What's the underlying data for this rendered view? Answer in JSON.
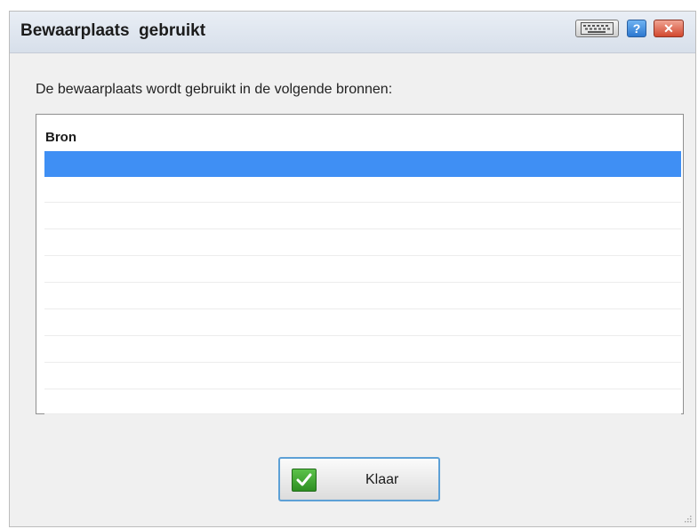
{
  "dialog": {
    "title": "Bewaarplaats  gebruikt",
    "message": "De bewaarplaats wordt gebruikt in de volgende bronnen:",
    "title_buttons": {
      "keyboard_icon": "keyboard-icon",
      "help_label": "?",
      "close_label": "✕"
    }
  },
  "table": {
    "column_header": "Bron",
    "rows": [
      "",
      "",
      "",
      "",
      "",
      "",
      "",
      "",
      "",
      ""
    ],
    "selected_row_index": 0
  },
  "buttons": {
    "ok_label": "Klaar",
    "ok_icon": "check-icon"
  },
  "colors": {
    "selection": "#3f8ff4",
    "button_border": "#5da0d6",
    "check_green": "#3aa52e",
    "close_red": "#d2482f",
    "help_blue": "#2d78d0"
  }
}
